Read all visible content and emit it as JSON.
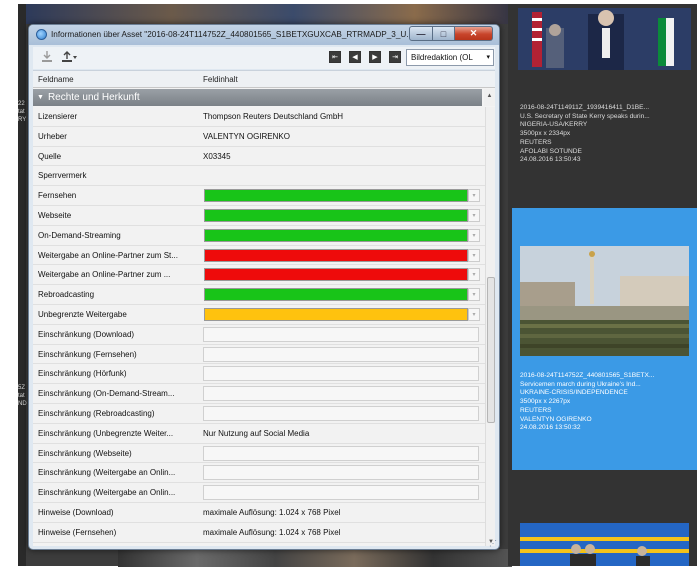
{
  "background": {
    "left_text_1": [
      "22",
      "tat",
      "RY"
    ],
    "left_text_2": [
      "5Z",
      "tat",
      "ND"
    ],
    "cards": [
      {
        "lines": [
          "2016-08-24T114911Z_1939416411_D1BE...",
          "U.S. Secretary of State Kerry speaks durin...",
          "NIGERIA-USA/KERRY",
          "3500px x 2334px",
          "REUTERS",
          "AFOLABI SOTUNDE",
          "24.08.2016 13:50:43"
        ]
      },
      {
        "lines": [
          "2016-08-24T114752Z_440801565_S1BETX...",
          "Servicemen march during Ukraine's Ind...",
          "UKRAINE-CRISIS/INDEPENDENCE",
          "3500px x 2267px",
          "REUTERS",
          "VALENTYN OGIRENKO",
          "24.08.2016 13:50:32"
        ],
        "selected": true
      }
    ]
  },
  "dialog": {
    "title": "Informationen über Asset \"2016-08-24T114752Z_440801565_S1BETXGUXCAB_RTRMADP_3_U...",
    "window_buttons": {
      "minimize": "—",
      "maximize": "□",
      "close": "✕"
    },
    "toolbar": {
      "dropdown_value": "Bildredaktion (OL",
      "dropdown_arrow": "▾",
      "nav_buttons": [
        "⇤",
        "◀",
        "▶",
        "⇥"
      ]
    },
    "columns": {
      "field_name": "Feldname",
      "field_content": "Feldinhalt"
    },
    "section": {
      "caret": "▼",
      "label": "Rechte und Herkunft"
    },
    "rows": [
      {
        "name": "Lizensierer",
        "value": "Thompson Reuters Deutschland GmbH",
        "type": "text"
      },
      {
        "name": "Urheber",
        "value": "VALENTYN OGIRENKO",
        "type": "text"
      },
      {
        "name": "Quelle",
        "value": "X03345",
        "type": "text"
      },
      {
        "name": "Sperrvermerk",
        "value": "",
        "type": "text"
      },
      {
        "name": "Fernsehen",
        "value": "",
        "type": "status",
        "color": "#18c418"
      },
      {
        "name": "Webseite",
        "value": "",
        "type": "status",
        "color": "#18c418"
      },
      {
        "name": "On-Demand-Streaming",
        "value": "",
        "type": "status",
        "color": "#18c418"
      },
      {
        "name": "Weitergabe an Online-Partner zum St...",
        "value": "",
        "type": "status",
        "color": "#ee0b0b"
      },
      {
        "name": "Weitergabe an Online-Partner zum ...",
        "value": "",
        "type": "status",
        "color": "#ee0b0b"
      },
      {
        "name": "Rebroadcasting",
        "value": "",
        "type": "status",
        "color": "#18c418"
      },
      {
        "name": "Unbegrenzte Weitergabe",
        "value": "",
        "type": "status",
        "color": "#ffc20e"
      },
      {
        "name": "Einschränkung (Download)",
        "value": "",
        "type": "box"
      },
      {
        "name": "Einschränkung (Fernsehen)",
        "value": "",
        "type": "box"
      },
      {
        "name": "Einschränkung (Hörfunk)",
        "value": "",
        "type": "box"
      },
      {
        "name": "Einschränkung (On-Demand-Stream...",
        "value": "",
        "type": "box"
      },
      {
        "name": "Einschränkung (Rebroadcasting)",
        "value": "",
        "type": "box"
      },
      {
        "name": "Einschränkung (Unbegrenzte Weiter...",
        "value": "Nur Nutzung auf Social Media",
        "type": "text"
      },
      {
        "name": "Einschränkung (Webseite)",
        "value": "",
        "type": "box"
      },
      {
        "name": "Einschränkung (Weitergabe an Onlin...",
        "value": "",
        "type": "box"
      },
      {
        "name": "Einschränkung (Weitergabe an Onlin...",
        "value": "",
        "type": "box"
      },
      {
        "name": "Hinweise (Download)",
        "value": "maximale Auflösung: 1.024 x 768 Pixel",
        "type": "text"
      },
      {
        "name": "Hinweise (Fernsehen)",
        "value": "maximale Auflösung: 1.024 x 768 Pixel",
        "type": "text"
      }
    ]
  }
}
